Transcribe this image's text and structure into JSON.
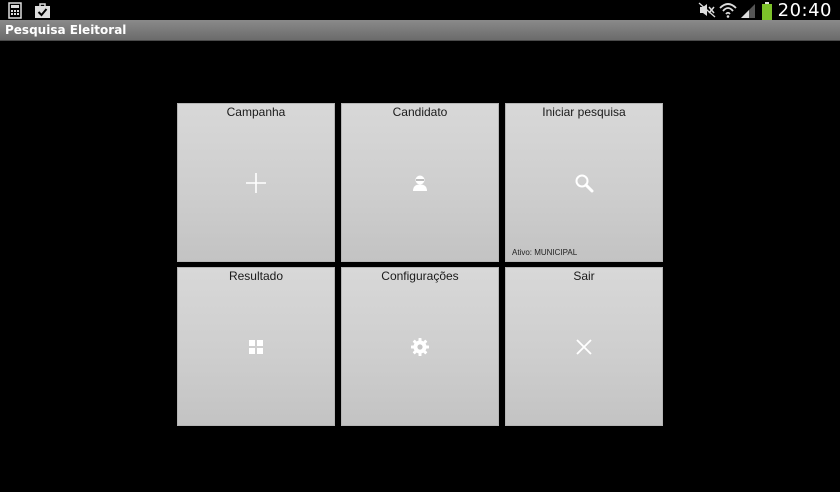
{
  "status_bar": {
    "left_icons": [
      "calculator-icon",
      "shopping-bag-check-icon"
    ],
    "right_icons": [
      "mute-icon",
      "wifi-icon",
      "signal-icon",
      "battery-icon"
    ],
    "time": "20:40",
    "battery_color": "#7cc12a"
  },
  "action_bar": {
    "title": "Pesquisa Eleitoral"
  },
  "tiles": [
    {
      "label": "Campanha",
      "icon": "plus-icon"
    },
    {
      "label": "Candidato",
      "icon": "person-icon"
    },
    {
      "label": "Iniciar pesquisa",
      "icon": "search-icon",
      "subtitle": "Ativo: MUNICIPAL"
    },
    {
      "label": "Resultado",
      "icon": "grid-icon"
    },
    {
      "label": "Configurações",
      "icon": "gear-icon"
    },
    {
      "label": "Sair",
      "icon": "close-icon"
    }
  ]
}
